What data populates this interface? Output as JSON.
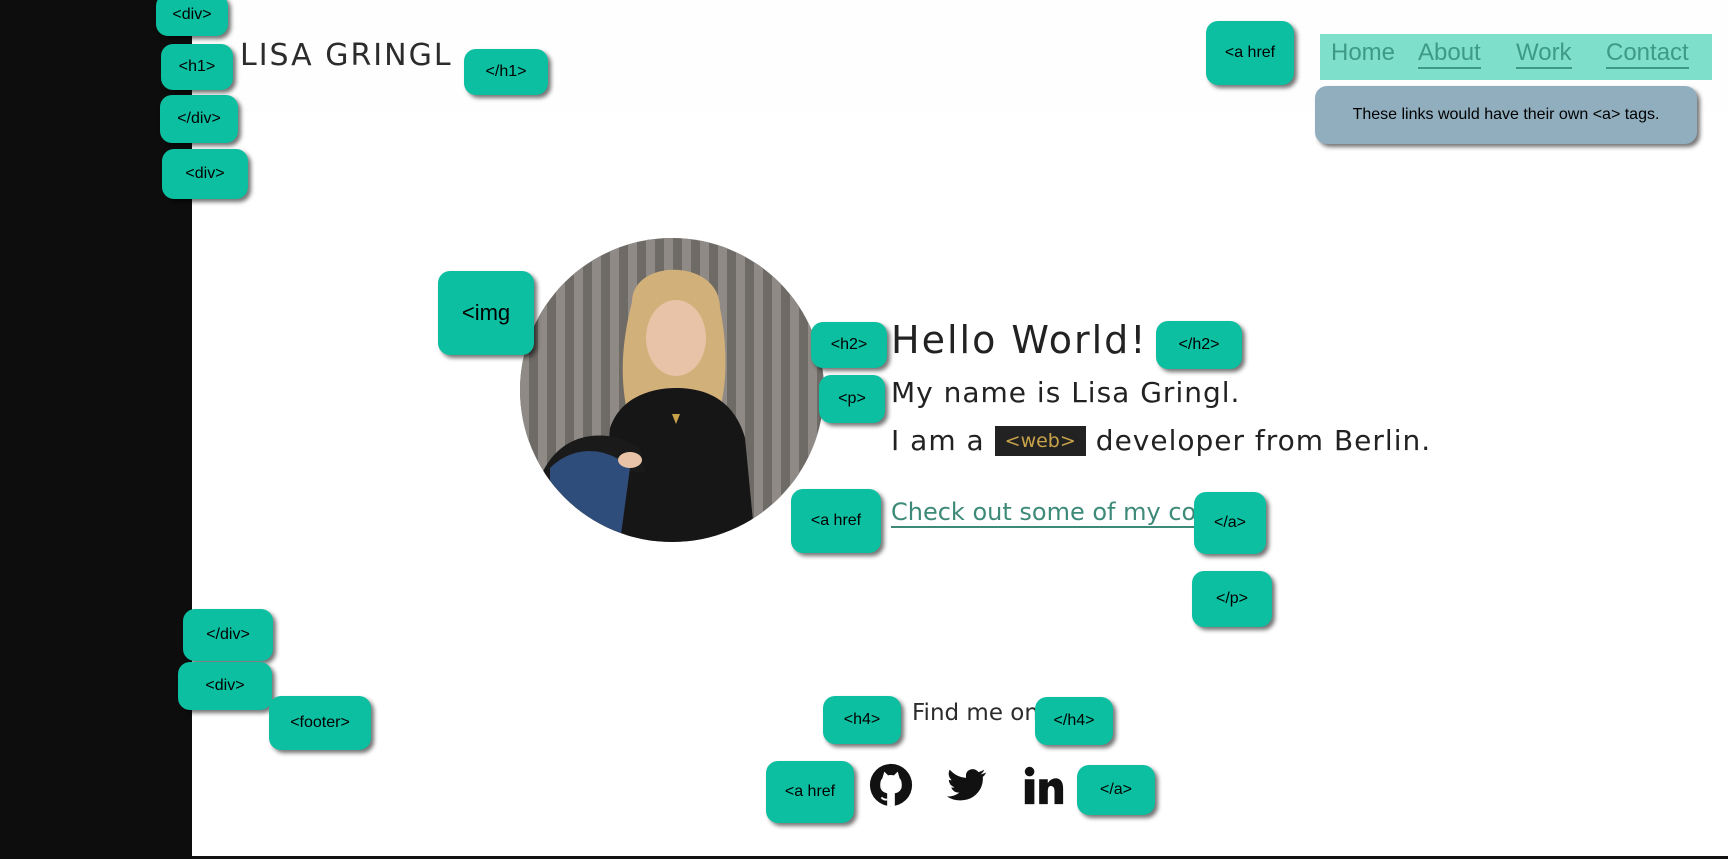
{
  "site": {
    "title": "LISA GRINGL"
  },
  "nav": {
    "items": [
      {
        "label": "Home"
      },
      {
        "label": "About"
      },
      {
        "label": "Work"
      },
      {
        "label": "Contact"
      }
    ],
    "note": "These links would have their own <a> tags."
  },
  "hero": {
    "heading": "Hello World!",
    "intro": "My name is Lisa Gringl.",
    "line2_prefix": "I am a",
    "web_chip": "<web>",
    "line2_suffix": "developer from Berlin.",
    "code_link": "Check out some of my code"
  },
  "footer": {
    "heading": "Find me on",
    "social": [
      {
        "icon": "github-icon"
      },
      {
        "icon": "twitter-icon"
      },
      {
        "icon": "linkedin-icon"
      }
    ]
  },
  "tags": {
    "div_open_1": "<div>",
    "h1_open": "<h1>",
    "h1_close": "</h1>",
    "div_close_1": "</div>",
    "div_open_2": "<div>",
    "nav_a_href": "<a href",
    "img_open": "<img",
    "h2_open": "<h2>",
    "h2_close": "</h2>",
    "p_open": "<p>",
    "a_href_code": "<a href",
    "a_close_code": "</a>",
    "p_close": "</p>",
    "div_close_2": "</div>",
    "div_open_3": "<div>",
    "footer_open": "<footer>",
    "h4_open": "<h4>",
    "h4_close": "</h4>",
    "a_href_social": "<a href",
    "a_close_social": "</a>"
  },
  "colors": {
    "tag_bg": "#0dbfa1",
    "nav_highlight": "#7edfcb",
    "link": "#3d9a86",
    "note_bg": "#91aebf",
    "chip_bg": "#222222",
    "chip_text": "#c9a34a"
  }
}
